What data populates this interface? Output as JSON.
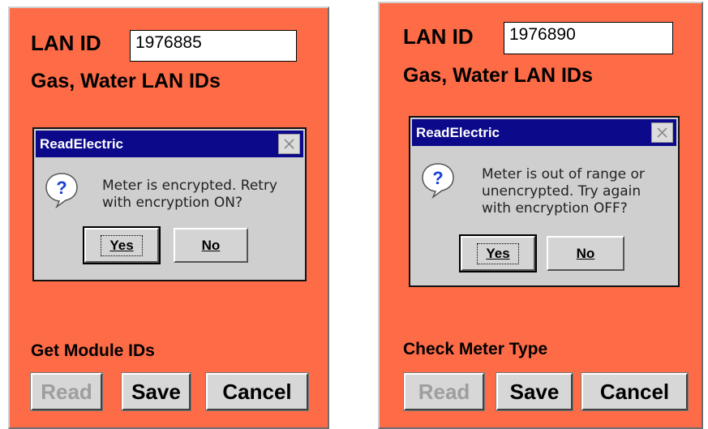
{
  "screens": [
    {
      "lan_id_label": "LAN ID",
      "lan_id_value": "1976885",
      "gas_water_label": "Gas, Water LAN IDs",
      "dialog": {
        "title": "ReadElectric",
        "message_line1": "Meter is encrypted. Retry",
        "message_line2": "with encryption ON?",
        "yes_label": "Yes",
        "no_label": "No"
      },
      "status_label": "Get Module IDs",
      "read_label": "Read",
      "save_label": "Save",
      "cancel_label": "Cancel"
    },
    {
      "lan_id_label": "LAN ID",
      "lan_id_value": "1976890",
      "gas_water_label": "Gas, Water LAN IDs",
      "dialog": {
        "title": "ReadElectric",
        "message_line1": "Meter is out of range or",
        "message_line2": "unencrypted. Try again",
        "message_line3": "with encryption OFF?",
        "yes_label": "Yes",
        "no_label": "No"
      },
      "status_label": "Check Meter Type",
      "read_label": "Read",
      "save_label": "Save",
      "cancel_label": "Cancel"
    }
  ],
  "colors": {
    "panel_bg": "#fd6b47",
    "titlebar_bg": "#0c0a8a",
    "dialog_bg": "#cfcfcf"
  },
  "icons": [
    "question-icon",
    "close-icon"
  ]
}
